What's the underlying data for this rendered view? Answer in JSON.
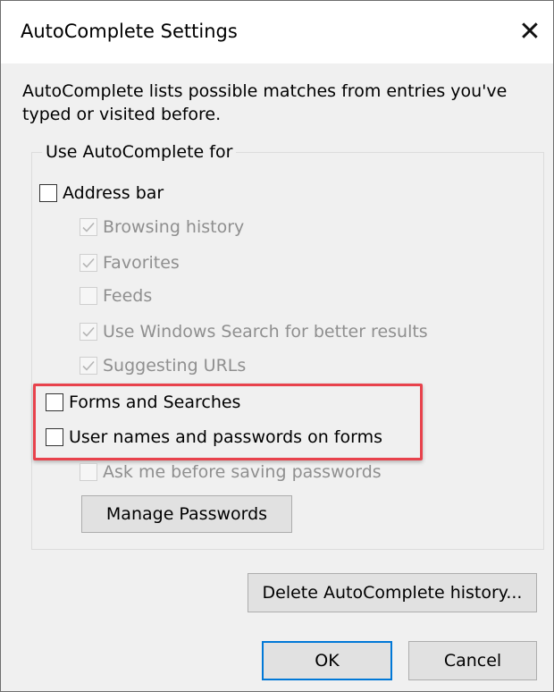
{
  "window": {
    "title": "AutoComplete Settings",
    "close_glyph": "✕"
  },
  "description": "AutoComplete lists possible matches from entries you've typed or visited before.",
  "group": {
    "legend": "Use AutoComplete for",
    "items": [
      {
        "label": "Address bar",
        "checked": false,
        "enabled": true
      },
      {
        "label": "Browsing history",
        "checked": true,
        "enabled": false
      },
      {
        "label": "Favorites",
        "checked": true,
        "enabled": false
      },
      {
        "label": "Feeds",
        "checked": false,
        "enabled": false
      },
      {
        "label": "Use Windows Search for better results",
        "checked": true,
        "enabled": false
      },
      {
        "label": "Suggesting URLs",
        "checked": true,
        "enabled": false
      },
      {
        "label": "Forms and Searches",
        "checked": false,
        "enabled": true
      },
      {
        "label": "User names and passwords on forms",
        "checked": false,
        "enabled": true
      },
      {
        "label": "Ask me before saving passwords",
        "checked": false,
        "enabled": false
      }
    ],
    "manage_passwords_label": "Manage Passwords"
  },
  "buttons": {
    "delete_history_label": "Delete AutoComplete history...",
    "ok_label": "OK",
    "cancel_label": "Cancel"
  },
  "colors": {
    "highlight": "#e8424c",
    "default_button_border": "#0078d7",
    "disabled_text": "#8f8f8f"
  }
}
